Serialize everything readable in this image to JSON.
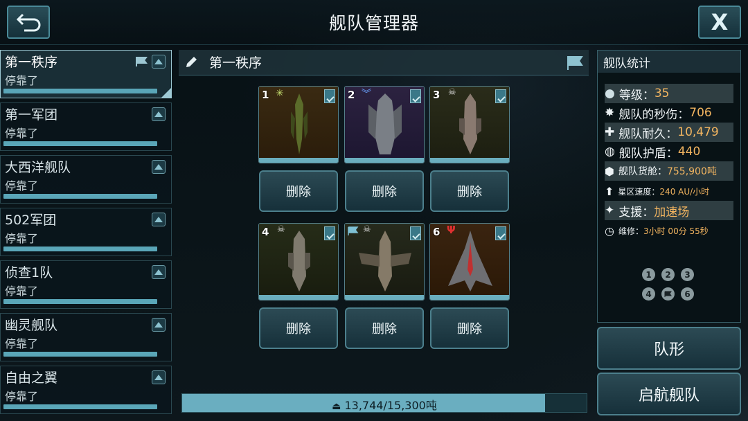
{
  "header": {
    "title": "舰队管理器",
    "back_icon": "back-arrow-icon",
    "close_label": "X"
  },
  "fleets": [
    {
      "name": "第一秩序",
      "status": "停靠了",
      "active": true,
      "flag": true
    },
    {
      "name": "第一军团",
      "status": "停靠了"
    },
    {
      "name": "大西洋舰队",
      "status": "停靠了"
    },
    {
      "name": "502军团",
      "status": "停靠了"
    },
    {
      "name": "侦查1队",
      "status": "停靠了"
    },
    {
      "name": "幽灵舰队",
      "status": "停靠了"
    },
    {
      "name": "自由之翼",
      "status": "停靠了"
    }
  ],
  "selected_fleet": {
    "name": "第一秩序"
  },
  "ships": [
    {
      "num": "1",
      "badge": "star-badge-icon",
      "bg": "#3a2a12",
      "hull": "#5b6b2a"
    },
    {
      "num": "2",
      "badge": "chevron-badge-icon",
      "bg": "#2c2240",
      "hull": "#7a7f86"
    },
    {
      "num": "3",
      "badge": "skull-badge-icon",
      "bg": "#2a2c1a",
      "hull": "#8a7a70"
    },
    {
      "num": "4",
      "badge": "skull-badge-icon",
      "bg": "#262c18",
      "hull": "#7f7a6e"
    },
    {
      "num": "",
      "badge": "flag-skull-badge-icon",
      "bg": "#262a1c",
      "hull": "#857a68"
    },
    {
      "num": "6",
      "badge": "trident-badge-icon",
      "bg": "#3a2410",
      "hull": "#6e6e72"
    }
  ],
  "delete_label": "删除",
  "cargo": {
    "text": "13,744/15,300吨",
    "fill_ratio": 0.898
  },
  "stats": {
    "title": "舰队统计",
    "level_label": "等级：",
    "level_value": "35",
    "dps_label": "舰队的秒伤：",
    "dps_value": "706",
    "hull_label": "舰队耐久：",
    "hull_value": "10,479",
    "shield_label": "舰队护盾：",
    "shield_value": "440",
    "cargo_label": "舰队货舱：",
    "cargo_value": "755,900吨",
    "speed_label": "星区速度：",
    "speed_value": "240 AU/小时",
    "support_label": "支援：",
    "support_value": "加速场",
    "repair_label": "维修：",
    "repair_value": "3小时 00分 55秒"
  },
  "formation_dots": [
    "1",
    "2",
    "3",
    "4",
    "",
    "6"
  ],
  "buttons": {
    "formation": "队形",
    "launch": "启航舰队"
  },
  "colors": {
    "accent": "#5aa6b8",
    "highlight": "#f3b560"
  }
}
